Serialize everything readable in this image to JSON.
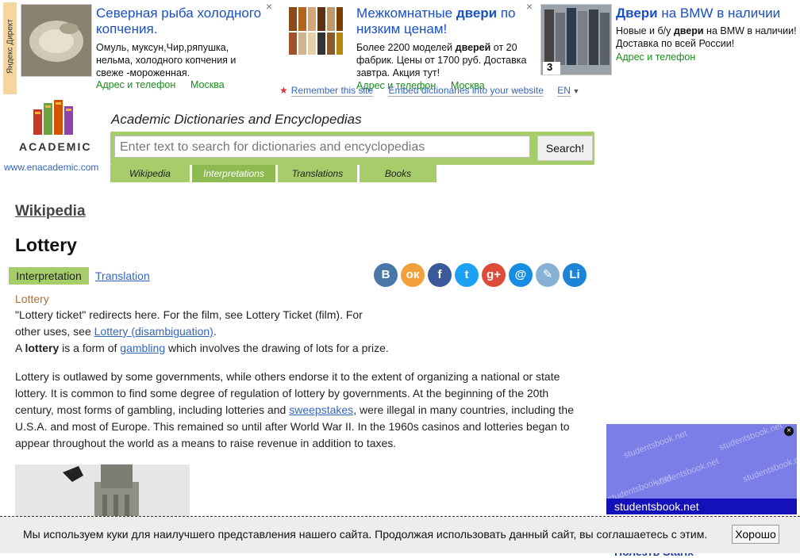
{
  "ads": {
    "yandex_label": "Яндекс Директ",
    "items": [
      {
        "title_html_parts": [
          "Северная рыба холодного копчения."
        ],
        "text": "Омуль, муксун,Чир,ряпушка, нельма, холодного копчения и свеже -мороженная.",
        "address": "Адрес и телефон",
        "city": "Москва"
      },
      {
        "title_plain_1": "Межкомнатные ",
        "title_bold": "двери",
        "title_plain_2": " по низким ценам!",
        "text_1": "Более 2200 моделей ",
        "text_bold": "дверей",
        "text_2": " от 20 фабрик. Цены от 1700 руб. Доставка завтра. Акция тут!",
        "address": "Адрес и телефон",
        "city": "Москва"
      },
      {
        "title_bold": "Двери",
        "title_plain": " на BMW в наличии",
        "text_1": "Новые и б/у ",
        "text_bold": "двери",
        "text_2": " на BMW в наличии! Доставка по всей России!",
        "address": "Адрес и телефон",
        "thumb_badge": "3"
      }
    ],
    "close_glyph": "×"
  },
  "toolbar": {
    "remember": "Remember this site",
    "embed": "Embed dictionaries into your website",
    "lang": "EN"
  },
  "header": {
    "brand": "ACADEMIC",
    "site_url": "www.enacademic.com",
    "title": "Academic Dictionaries and Encyclopedias",
    "search_placeholder": "Enter text to search for dictionaries and encyclopedias",
    "search_button": "Search!",
    "tabs": [
      "Wikipedia",
      "Interpretations",
      "Translations",
      "Books"
    ]
  },
  "article": {
    "source": "Wikipedia",
    "title": "Lottery",
    "mode_interpretation": "Interpretation",
    "mode_translation": "Translation",
    "category": "Lottery",
    "social": [
      {
        "name": "vk-icon",
        "glyph": "В",
        "color": "#4a76a8"
      },
      {
        "name": "odnoklassniki-icon",
        "glyph": "ок",
        "color": "#f2a03c"
      },
      {
        "name": "facebook-icon",
        "glyph": "f",
        "color": "#3b5998"
      },
      {
        "name": "twitter-icon",
        "glyph": "t",
        "color": "#1da1f2"
      },
      {
        "name": "google-plus-icon",
        "glyph": "g+",
        "color": "#dd4b39"
      },
      {
        "name": "mail-icon",
        "glyph": "@",
        "color": "#168de2"
      },
      {
        "name": "livejournal-icon",
        "glyph": "✎",
        "color": "#87b2d6"
      },
      {
        "name": "liveinternet-icon",
        "glyph": "Li",
        "color": "#1c84d6"
      }
    ],
    "p1": {
      "a": "\"Lottery ticket\" redirects here. For the film, see Lottery Ticket (film). For other uses, see ",
      "link": "Lottery (disambiguation)",
      "b": "."
    },
    "p2": {
      "a": "A ",
      "bold": "lottery",
      "b": " is a form of ",
      "link": "gambling",
      "c": " which involves the drawing of lots for a prize."
    },
    "p3": {
      "a": "Lottery is outlawed by some governments, while others endorse it to the extent of organizing a national or state lottery. It is common to find some degree of regulation of lottery by governments. At the beginning of the 20th century, most forms of gambling, including lotteries and ",
      "link": "sweepstakes",
      "b": ", were illegal in many countries, including the U.S.A. and most of Europe. This remained so until after World War II. In the 1960s casinos and lotteries began to appear throughout the world as a means to raise revenue in addition to taxes."
    }
  },
  "sidebar_ad": {
    "watermark": "studentsbook.net",
    "label": "studentsbook.net",
    "close": "×"
  },
  "cookie": {
    "text": "Мы используем куки для наилучшего представления нашего сайта. Продолжая использовать данный сайт, вы соглашаетесь с этим.",
    "button": "Хорошо"
  },
  "bottom_link": "Полезть Starix"
}
